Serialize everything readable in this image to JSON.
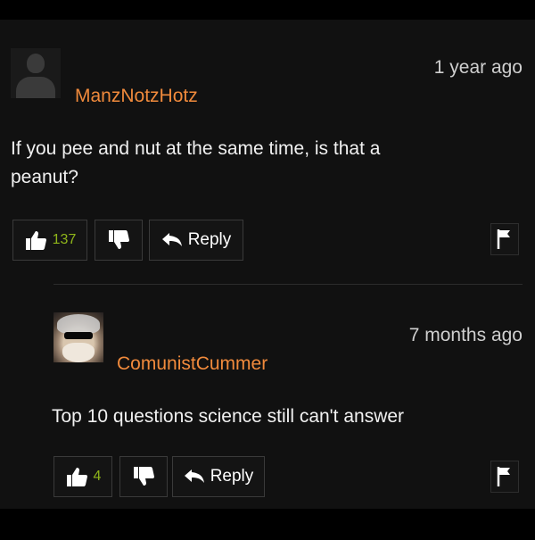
{
  "comments": [
    {
      "username": "ManzNotzHotz",
      "timestamp": "1 year ago",
      "text_line1": "If you pee and nut at the same time, is that a",
      "text_line2": "peanut?",
      "likes": "137",
      "reply_label": "Reply"
    },
    {
      "username": "ComunistCummer",
      "timestamp": "7 months ago",
      "text_line1": "Top 10 questions science still can't answer",
      "likes": "4",
      "reply_label": "Reply"
    }
  ],
  "colors": {
    "username": "#f08a3c",
    "like_count": "#8fb51a",
    "background": "#111111"
  },
  "icons": [
    "user-default-avatar-icon",
    "thumbs-up-icon",
    "thumbs-down-icon",
    "reply-arrow-icon",
    "flag-icon"
  ]
}
